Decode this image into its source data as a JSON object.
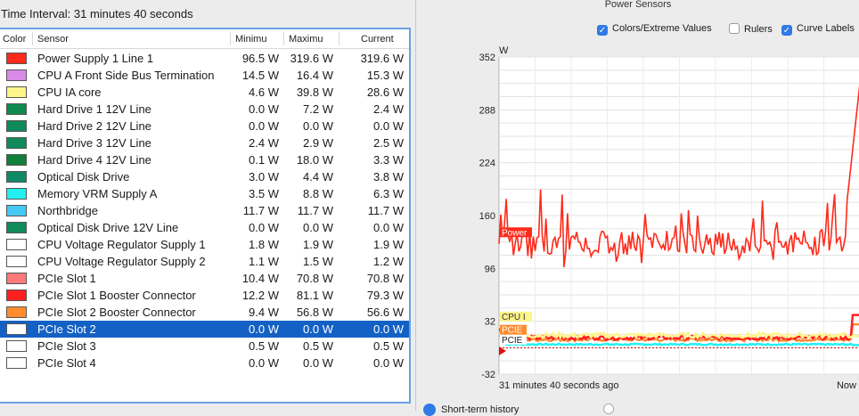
{
  "left": {
    "interval": "Time Interval: 31 minutes 40 seconds",
    "columns": {
      "color": "Color",
      "sensor": "Sensor",
      "min": "Minimu",
      "max": "Maximu",
      "cur": "Current"
    },
    "rows": [
      {
        "name": "Power Supply 1 Line 1",
        "min": "96.5 W",
        "max": "319.6 W",
        "cur": "319.6 W",
        "color": "#ff2a1a"
      },
      {
        "name": "CPU A Front Side Bus Termination",
        "min": "14.5 W",
        "max": "16.4 W",
        "cur": "15.3 W",
        "color": "#d98ae8"
      },
      {
        "name": "CPU IA core",
        "min": "4.6 W",
        "max": "39.8 W",
        "cur": "28.6 W",
        "color": "#fdf58a"
      },
      {
        "name": "Hard Drive 1 12V Line",
        "min": "0.0 W",
        "max": "7.2 W",
        "cur": "2.4 W",
        "color": "#0f8a4f"
      },
      {
        "name": "Hard Drive 2 12V Line",
        "min": "0.0 W",
        "max": "0.0 W",
        "cur": "0.0 W",
        "color": "#0f8a5a"
      },
      {
        "name": "Hard Drive 3 12V Line",
        "min": "2.4 W",
        "max": "2.9 W",
        "cur": "2.5 W",
        "color": "#0f8a5a"
      },
      {
        "name": "Hard Drive 4 12V Line",
        "min": "0.1 W",
        "max": "18.0 W",
        "cur": "3.3 W",
        "color": "#0f7f3a"
      },
      {
        "name": "Optical Disk Drive",
        "min": "3.0 W",
        "max": "4.4 W",
        "cur": "3.8 W",
        "color": "#0f8a66"
      },
      {
        "name": "Memory VRM Supply A",
        "min": "3.5 W",
        "max": "8.8 W",
        "cur": "6.3 W",
        "color": "#22f0f0"
      },
      {
        "name": "Northbridge",
        "min": "11.7 W",
        "max": "11.7 W",
        "cur": "11.7 W",
        "color": "#44c8f4"
      },
      {
        "name": "Optical Disk Drive 12V Line",
        "min": "0.0 W",
        "max": "0.0 W",
        "cur": "0.0 W",
        "color": "#0f8a5a"
      },
      {
        "name": "CPU Voltage Regulator Supply 1",
        "min": "1.8 W",
        "max": "1.9 W",
        "cur": "1.9 W",
        "color": "#ffffff"
      },
      {
        "name": "CPU Voltage Regulator Supply 2",
        "min": "1.1 W",
        "max": "1.5 W",
        "cur": "1.2 W",
        "color": "#ffffff"
      },
      {
        "name": "PCIe Slot 1",
        "min": "10.4 W",
        "max": "70.8 W",
        "cur": "70.8 W",
        "color": "#ff7a7a"
      },
      {
        "name": "PCIe Slot 1 Booster Connector",
        "min": "12.2 W",
        "max": "81.1 W",
        "cur": "79.3 W",
        "color": "#ff1f1f"
      },
      {
        "name": "PCIe Slot 2 Booster Connector",
        "min": "9.4 W",
        "max": "56.8 W",
        "cur": "56.6 W",
        "color": "#ff8c2e"
      },
      {
        "name": "PCIe Slot 2",
        "min": "0.0 W",
        "max": "0.0 W",
        "cur": "0.0 W",
        "color": "#ffffff",
        "selected": true
      },
      {
        "name": "PCIe Slot 3",
        "min": "0.5 W",
        "max": "0.5 W",
        "cur": "0.5 W",
        "color": "#ffffff"
      },
      {
        "name": "PCIe Slot 4",
        "min": "0.0 W",
        "max": "0.0 W",
        "cur": "0.0 W",
        "color": "#ffffff"
      }
    ]
  },
  "right": {
    "title": "Power Sensors",
    "checkboxes": [
      {
        "label": "Colors/Extreme Values",
        "checked": true
      },
      {
        "label": "Rulers",
        "checked": false
      },
      {
        "label": "Curve Labels",
        "checked": true
      }
    ],
    "radio_label": "Short-term history"
  },
  "chart_data": {
    "type": "line",
    "ylabel": "W",
    "yticks": [
      352,
      288,
      224,
      160,
      96,
      32,
      -32
    ],
    "ylim": [
      -32,
      352
    ],
    "xlabel_start": "31 minutes 40 seconds ago",
    "xlabel_end": "Now",
    "grid": true,
    "curve_labels": [
      "Power",
      "CPU I",
      "PCIE",
      "PCIE"
    ],
    "series": [
      {
        "name": "Power Supply 1 Line 1",
        "color": "#ff2a1a",
        "approx_level": 130,
        "end_value": 319.6
      },
      {
        "name": "CPU IA core",
        "color": "#fdf58a",
        "approx_level": 15,
        "end_value": 28.6
      },
      {
        "name": "PCIe Slot 1 Booster Connector",
        "color": "#ff1f1f",
        "approx_level": 12,
        "end_value": 79.3
      },
      {
        "name": "PCIe Slot 2 Booster Connector",
        "color": "#ff8c2e",
        "approx_level": 10,
        "end_value": 56.6
      },
      {
        "name": "Memory VRM Supply A",
        "color": "#22f0f0",
        "approx_level": 4,
        "end_value": 6.3
      }
    ]
  }
}
